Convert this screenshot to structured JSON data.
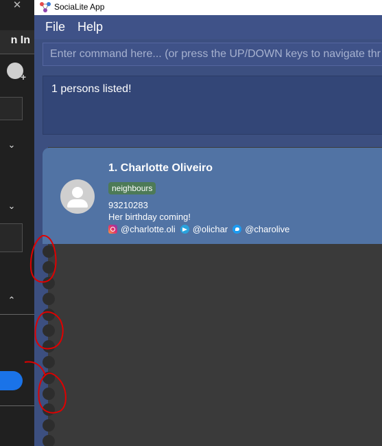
{
  "background_app": {
    "sign_in_text": "n In",
    "close_glyph": "✕",
    "icons": [
      "close-icon",
      "person-add-icon",
      "chevron-down-icon",
      "chevron-up-icon"
    ]
  },
  "window": {
    "title": "SociaLite App",
    "icon": "socialite-app-icon"
  },
  "menubar": {
    "file_label": "File",
    "help_label": "Help"
  },
  "command": {
    "placeholder": "Enter command here... (or press the UP/DOWN keys to navigate thr",
    "value": ""
  },
  "result": {
    "text": "1 persons listed!"
  },
  "persons": [
    {
      "index_name": "1.  Charlotte Oliveiro",
      "tag": "neighbours",
      "phone": "93210283",
      "remark": "Her birthday coming!",
      "socials": [
        {
          "icon": "instagram-icon",
          "handle": "@charlotte.oli"
        },
        {
          "icon": "telegram-icon",
          "handle": "@olichar"
        },
        {
          "icon": "twitter-icon",
          "handle": "@charolive"
        }
      ]
    }
  ],
  "colors": {
    "window_bg": "#3c4f80",
    "result_bg": "#334677",
    "card_bg": "#5173a4",
    "tag_bg": "#4d7a57",
    "list_bg": "#3a3a3a",
    "annotation": "#e00000"
  }
}
